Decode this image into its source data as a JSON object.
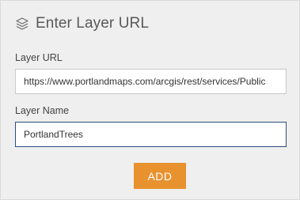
{
  "header": {
    "icon": "layers-icon",
    "title": "Enter Layer URL"
  },
  "layer_url": {
    "label": "Layer URL",
    "value": "https://www.portlandmaps.com/arcgis/rest/services/Public"
  },
  "layer_name": {
    "label": "Layer Name",
    "value": "PortlandTrees"
  },
  "actions": {
    "add_label": "ADD",
    "add_color": "#e8912f"
  }
}
